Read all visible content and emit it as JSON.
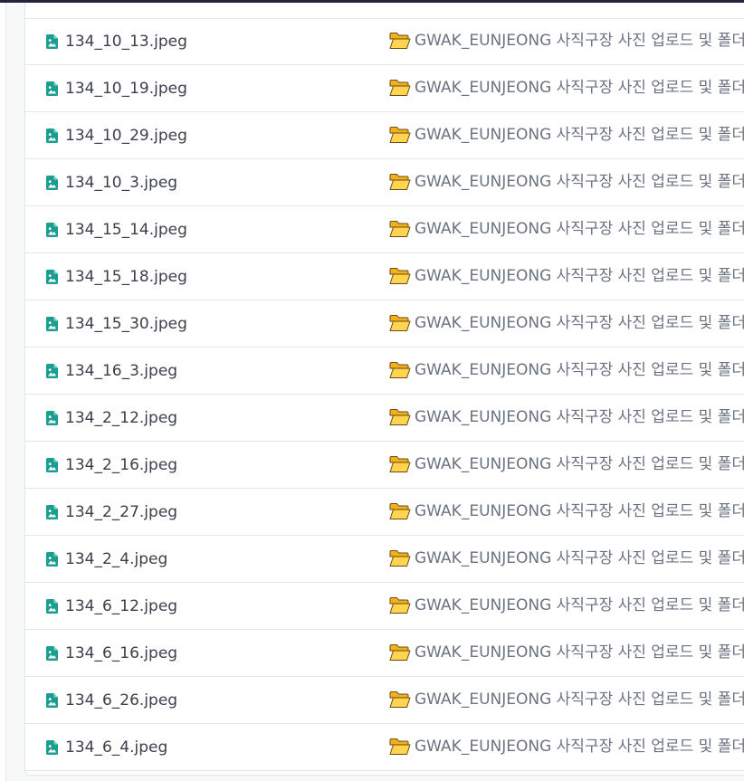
{
  "colors": {
    "topbar": "#23253d",
    "file_icon": "#1a9e8f",
    "file_name_text": "#3a3f4a",
    "folder_text": "#6b7280",
    "row_border": "#e2e5ea"
  },
  "icons": {
    "file": "image-file-icon",
    "folder": "open-folder-icon"
  },
  "files": [
    {
      "name": "134_10_13.jpeg",
      "folder": "GWAK_EUNJEONG 사직구장 사진 업로드 및 폴더"
    },
    {
      "name": "134_10_19.jpeg",
      "folder": "GWAK_EUNJEONG 사직구장 사진 업로드 및 폴더"
    },
    {
      "name": "134_10_29.jpeg",
      "folder": "GWAK_EUNJEONG 사직구장 사진 업로드 및 폴더"
    },
    {
      "name": "134_10_3.jpeg",
      "folder": "GWAK_EUNJEONG 사직구장 사진 업로드 및 폴더"
    },
    {
      "name": "134_15_14.jpeg",
      "folder": "GWAK_EUNJEONG 사직구장 사진 업로드 및 폴더"
    },
    {
      "name": "134_15_18.jpeg",
      "folder": "GWAK_EUNJEONG 사직구장 사진 업로드 및 폴더"
    },
    {
      "name": "134_15_30.jpeg",
      "folder": "GWAK_EUNJEONG 사직구장 사진 업로드 및 폴더"
    },
    {
      "name": "134_16_3.jpeg",
      "folder": "GWAK_EUNJEONG 사직구장 사진 업로드 및 폴더"
    },
    {
      "name": "134_2_12.jpeg",
      "folder": "GWAK_EUNJEONG 사직구장 사진 업로드 및 폴더"
    },
    {
      "name": "134_2_16.jpeg",
      "folder": "GWAK_EUNJEONG 사직구장 사진 업로드 및 폴더"
    },
    {
      "name": "134_2_27.jpeg",
      "folder": "GWAK_EUNJEONG 사직구장 사진 업로드 및 폴더"
    },
    {
      "name": "134_2_4.jpeg",
      "folder": "GWAK_EUNJEONG 사직구장 사진 업로드 및 폴더"
    },
    {
      "name": "134_6_12.jpeg",
      "folder": "GWAK_EUNJEONG 사직구장 사진 업로드 및 폴더"
    },
    {
      "name": "134_6_16.jpeg",
      "folder": "GWAK_EUNJEONG 사직구장 사진 업로드 및 폴더"
    },
    {
      "name": "134_6_26.jpeg",
      "folder": "GWAK_EUNJEONG 사직구장 사진 업로드 및 폴더"
    },
    {
      "name": "134_6_4.jpeg",
      "folder": "GWAK_EUNJEONG 사직구장 사진 업로드 및 폴더"
    }
  ]
}
